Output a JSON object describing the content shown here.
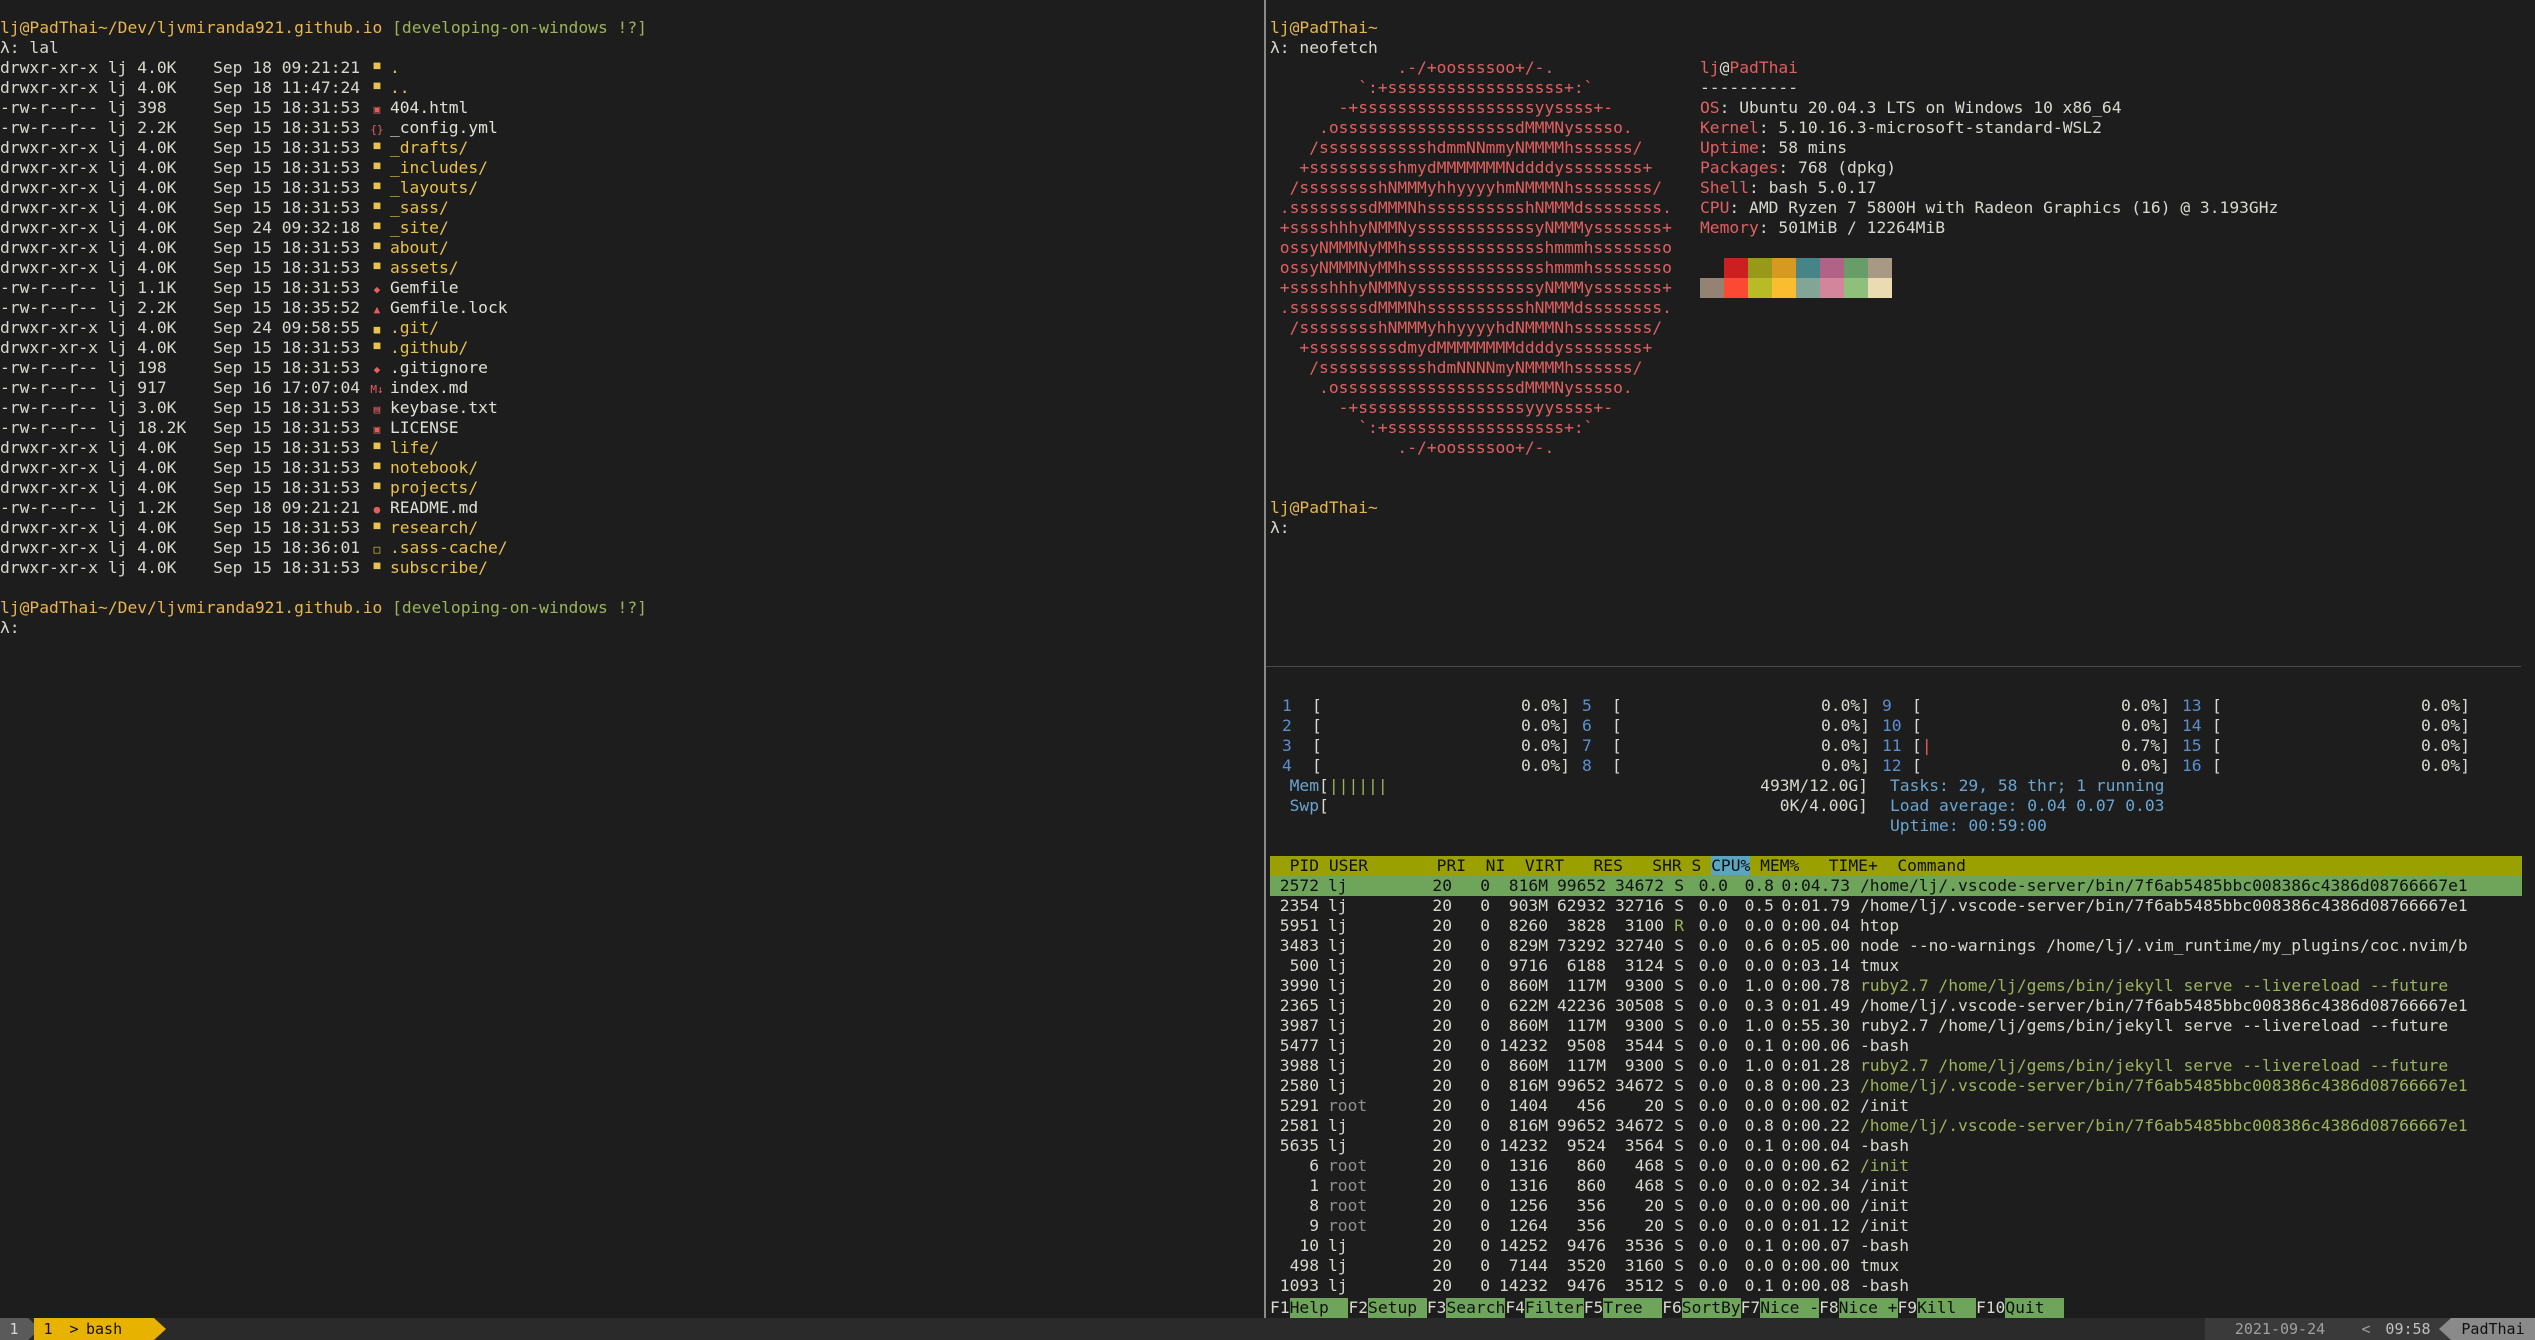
{
  "left": {
    "prompt_user": "lj@PadThai",
    "prompt_path": "~/Dev/ljvmiranda921.github.io",
    "prompt_git": "[developing-on-windows !?]",
    "command": "λ: lal",
    "entries": [
      {
        "perm": "drwxr-xr-x",
        "owner": "lj",
        "size": "4.0K",
        "date": "Sep 18 09:21:21",
        "icon": "folder-icon",
        "glyph": "▀",
        "name": ".",
        "dir": true
      },
      {
        "perm": "drwxr-xr-x",
        "owner": "lj",
        "size": "4.0K",
        "date": "Sep 18 11:47:24",
        "icon": "folder-icon",
        "glyph": "▀",
        "name": "..",
        "dir": true
      },
      {
        "perm": "-rw-r--r--",
        "owner": "lj",
        "size": "398",
        "date": "Sep 15 18:31:53",
        "icon": "html-icon",
        "glyph": "▣",
        "name": "404.html",
        "dir": false
      },
      {
        "perm": "-rw-r--r--",
        "owner": "lj",
        "size": "2.2K",
        "date": "Sep 15 18:31:53",
        "icon": "config-icon",
        "glyph": "{}",
        "name": "_config.yml",
        "dir": false
      },
      {
        "perm": "drwxr-xr-x",
        "owner": "lj",
        "size": "4.0K",
        "date": "Sep 15 18:31:53",
        "icon": "folder-icon",
        "glyph": "▀",
        "name": "_drafts/",
        "dir": true
      },
      {
        "perm": "drwxr-xr-x",
        "owner": "lj",
        "size": "4.0K",
        "date": "Sep 15 18:31:53",
        "icon": "folder-includes-icon",
        "glyph": "▀",
        "name": "_includes/",
        "dir": true
      },
      {
        "perm": "drwxr-xr-x",
        "owner": "lj",
        "size": "4.0K",
        "date": "Sep 15 18:31:53",
        "icon": "folder-icon",
        "glyph": "▀",
        "name": "_layouts/",
        "dir": true
      },
      {
        "perm": "drwxr-xr-x",
        "owner": "lj",
        "size": "4.0K",
        "date": "Sep 15 18:31:53",
        "icon": "folder-icon",
        "glyph": "▀",
        "name": "_sass/",
        "dir": true
      },
      {
        "perm": "drwxr-xr-x",
        "owner": "lj",
        "size": "4.0K",
        "date": "Sep 24 09:32:18",
        "icon": "folder-icon",
        "glyph": "▀",
        "name": "_site/",
        "dir": true
      },
      {
        "perm": "drwxr-xr-x",
        "owner": "lj",
        "size": "4.0K",
        "date": "Sep 15 18:31:53",
        "icon": "folder-icon",
        "glyph": "▀",
        "name": "about/",
        "dir": true
      },
      {
        "perm": "drwxr-xr-x",
        "owner": "lj",
        "size": "4.0K",
        "date": "Sep 15 18:31:53",
        "icon": "folder-icon",
        "glyph": "▀",
        "name": "assets/",
        "dir": true
      },
      {
        "perm": "-rw-r--r--",
        "owner": "lj",
        "size": "1.1K",
        "date": "Sep 15 18:31:53",
        "icon": "ruby-icon",
        "glyph": "◆",
        "name": "Gemfile",
        "dir": false
      },
      {
        "perm": "-rw-r--r--",
        "owner": "lj",
        "size": "2.2K",
        "date": "Sep 15 18:35:52",
        "icon": "lock-icon",
        "glyph": "▲",
        "name": "Gemfile.lock",
        "dir": false
      },
      {
        "perm": "drwxr-xr-x",
        "owner": "lj",
        "size": "4.0K",
        "date": "Sep 24 09:58:55",
        "icon": "git-folder-icon",
        "glyph": "■",
        "name": ".git/",
        "dir": true
      },
      {
        "perm": "drwxr-xr-x",
        "owner": "lj",
        "size": "4.0K",
        "date": "Sep 15 18:31:53",
        "icon": "github-folder-icon",
        "glyph": "▀",
        "name": ".github/",
        "dir": true
      },
      {
        "perm": "-rw-r--r--",
        "owner": "lj",
        "size": "198",
        "date": "Sep 15 18:31:53",
        "icon": "gitignore-icon",
        "glyph": "◆",
        "name": ".gitignore",
        "dir": false
      },
      {
        "perm": "-rw-r--r--",
        "owner": "lj",
        "size": "917",
        "date": "Sep 16 17:07:04",
        "icon": "markdown-icon",
        "glyph": "M↓",
        "name": "index.md",
        "dir": false
      },
      {
        "perm": "-rw-r--r--",
        "owner": "lj",
        "size": "3.0K",
        "date": "Sep 15 18:31:53",
        "icon": "text-file-icon",
        "glyph": "▤",
        "name": "keybase.txt",
        "dir": false
      },
      {
        "perm": "-rw-r--r--",
        "owner": "lj",
        "size": "18.2K",
        "date": "Sep 15 18:31:53",
        "icon": "license-icon",
        "glyph": "▣",
        "name": "LICENSE",
        "dir": false
      },
      {
        "perm": "drwxr-xr-x",
        "owner": "lj",
        "size": "4.0K",
        "date": "Sep 15 18:31:53",
        "icon": "folder-icon",
        "glyph": "▀",
        "name": "life/",
        "dir": true
      },
      {
        "perm": "drwxr-xr-x",
        "owner": "lj",
        "size": "4.0K",
        "date": "Sep 15 18:31:53",
        "icon": "folder-icon",
        "glyph": "▀",
        "name": "notebook/",
        "dir": true
      },
      {
        "perm": "drwxr-xr-x",
        "owner": "lj",
        "size": "4.0K",
        "date": "Sep 15 18:31:53",
        "icon": "folder-icon",
        "glyph": "▀",
        "name": "projects/",
        "dir": true
      },
      {
        "perm": "-rw-r--r--",
        "owner": "lj",
        "size": "1.2K",
        "date": "Sep 18 09:21:21",
        "icon": "info-icon",
        "glyph": "●",
        "name": "README.md",
        "dir": false
      },
      {
        "perm": "drwxr-xr-x",
        "owner": "lj",
        "size": "4.0K",
        "date": "Sep 15 18:31:53",
        "icon": "folder-icon",
        "glyph": "▀",
        "name": "research/",
        "dir": true
      },
      {
        "perm": "drwxr-xr-x",
        "owner": "lj",
        "size": "4.0K",
        "date": "Sep 15 18:36:01",
        "icon": "folder-open-icon",
        "glyph": "□",
        "name": ".sass-cache/",
        "dir": true
      },
      {
        "perm": "drwxr-xr-x",
        "owner": "lj",
        "size": "4.0K",
        "date": "Sep 15 18:31:53",
        "icon": "folder-icon",
        "glyph": "▀",
        "name": "subscribe/",
        "dir": true
      }
    ],
    "prompt2_user": "lj@PadThai",
    "prompt2_path": "~/Dev/ljvmiranda921.github.io",
    "prompt2_git": "[developing-on-windows !?]",
    "prompt2_cmd": "λ:"
  },
  "neofetch": {
    "prompt": "lj@PadThai",
    "prompt_tail": "~",
    "command": "λ: neofetch",
    "logo": [
      "             .-/+oossssoo+/-.",
      "         `:+ssssssssssssssssss+:`",
      "       -+ssssssssssssssssssyyssss+-",
      "     .ossssssssssssssssssdMMMNysssso.",
      "    /ssssssssssshdmmNNmmyNMMMMhssssss/",
      "   +ssssssssshmydMMMMMMMNddddyssssssss+",
      "  /sssssssshNMMMyhhyyyyhmNMMMNhssssssss/",
      " .ssssssssdMMMNhsssssssssshNMMMdssssssss.",
      " +sssshhhyNMMNyssssssssssssyNMMMysssssss+",
      " ossyNMMMNyMMhsssssssssssssshmmmhssssssso",
      " ossyNMMMNyMMhsssssssssssssshmmmhssssssso",
      " +sssshhhyNMMNyssssssssssssyNMMMysssssss+",
      " .ssssssssdMMMNhsssssssssshNMMMdssssssss.",
      "  /sssssssshNMMMyhhyyyyhdNMMMNhssssssss/",
      "   +sssssssssdmydMMMMMMMMddddyssssssss+",
      "    /ssssssssssshdmNNNNmyNMMMMhssssss/",
      "     .ossssssssssssssssssdMMMNysssso.",
      "       -+sssssssssssssssssyyyssss+-",
      "         `:+ssssssssssssssssss+:`",
      "             .-/+oossssoo+/-."
    ],
    "title_user": "lj",
    "title_at": "@",
    "title_host": "PadThai",
    "separator": "----------",
    "info": [
      {
        "key": "OS",
        "value": ": Ubuntu 20.04.3 LTS on Windows 10 x86_64"
      },
      {
        "key": "Kernel",
        "value": ": 5.10.16.3-microsoft-standard-WSL2"
      },
      {
        "key": "Uptime",
        "value": ": 58 mins"
      },
      {
        "key": "Packages",
        "value": ": 768 (dpkg)"
      },
      {
        "key": "Shell",
        "value": ": bash 5.0.17"
      },
      {
        "key": "CPU",
        "value": ": AMD Ryzen 7 5800H with Radeon Graphics (16) @ 3.193GHz"
      },
      {
        "key": "Memory",
        "value": ": 501MiB / 12264MiB"
      }
    ],
    "palette_top": [
      "#1d1d1d",
      "#cc2020",
      "#98981a",
      "#d79921",
      "#458588",
      "#b16286",
      "#689d6a",
      "#a89984"
    ],
    "palette_bottom": [
      "#928374",
      "#fb4934",
      "#b8bb26",
      "#fabd2f",
      "#83a598",
      "#d3869b",
      "#8ec07c",
      "#ebdbb2"
    ],
    "prompt2": "lj@PadThai",
    "prompt2_tail": "~",
    "prompt2_cmd": "λ:"
  },
  "htop": {
    "cpus": [
      {
        "n": "1",
        "v": "0.0%]"
      },
      {
        "n": "2",
        "v": "0.0%]"
      },
      {
        "n": "3",
        "v": "0.0%]"
      },
      {
        "n": "4",
        "v": "0.0%]"
      },
      {
        "n": "5",
        "v": "0.0%]"
      },
      {
        "n": "6",
        "v": "0.0%]"
      },
      {
        "n": "7",
        "v": "0.0%]"
      },
      {
        "n": "8",
        "v": "0.0%]"
      },
      {
        "n": "9",
        "v": "0.0%]"
      },
      {
        "n": "10",
        "v": "0.0%]"
      },
      {
        "n": "11",
        "v": "0.7%]"
      },
      {
        "n": "12",
        "v": "0.0%]"
      },
      {
        "n": "13",
        "v": "0.0%]"
      },
      {
        "n": "14",
        "v": "0.0%]"
      },
      {
        "n": "15",
        "v": "0.0%]"
      },
      {
        "n": "16",
        "v": "0.0%]"
      }
    ],
    "mem_label": "Mem",
    "mem_bar": "||||||",
    "mem_value": "493M/12.0G]",
    "swp_label": "Swp",
    "swp_value": "0K/4.00G]",
    "tasks": "Tasks: 29, 58 thr; 1 running",
    "load": "Load average: 0.04 0.07 0.03",
    "uptime": "Uptime: 00:59:00",
    "header": "  PID USER       PRI  NI  VIRT   RES   SHR S ",
    "header_sort": "CPU%",
    "header_tail": " MEM%   TIME+  Command",
    "processes": [
      {
        "pid": " 2572",
        "user": "lj  ",
        "pri": "20",
        "ni": "0",
        "virt": " 816M",
        "res": "99652",
        "shr": "34672",
        "s": "S",
        "cpu": "0.0",
        "mem": "0.8",
        "time": "0:04.73",
        "cmd": "/home/lj/.vscode-server/bin/7f6ab5485bbc008386c4386d08766667e1",
        "sel": true,
        "kind": ""
      },
      {
        "pid": " 2354",
        "user": "lj  ",
        "pri": "20",
        "ni": "0",
        "virt": " 903M",
        "res": "62932",
        "shr": "32716",
        "s": "S",
        "cpu": "0.0",
        "mem": "0.5",
        "time": "0:01.79",
        "cmd": "/home/lj/.vscode-server/bin/7f6ab5485bbc008386c4386d08766667e1",
        "sel": false,
        "kind": ""
      },
      {
        "pid": " 5951",
        "user": "lj  ",
        "pri": "20",
        "ni": "0",
        "virt": " 8260",
        "res": " 3828",
        "shr": " 3100",
        "s": "R",
        "cpu": "0.0",
        "mem": "0.0",
        "time": "0:00.04",
        "cmd": "htop",
        "sel": false,
        "kind": ""
      },
      {
        "pid": " 3483",
        "user": "lj  ",
        "pri": "20",
        "ni": "0",
        "virt": " 829M",
        "res": "73292",
        "shr": "32740",
        "s": "S",
        "cpu": "0.0",
        "mem": "0.6",
        "time": "0:05.00",
        "cmd": "node --no-warnings /home/lj/.vim_runtime/my_plugins/coc.nvim/b",
        "sel": false,
        "kind": ""
      },
      {
        "pid": "  500",
        "user": "lj  ",
        "pri": "20",
        "ni": "0",
        "virt": " 9716",
        "res": " 6188",
        "shr": " 3124",
        "s": "S",
        "cpu": "0.0",
        "mem": "0.0",
        "time": "0:03.14",
        "cmd": "tmux",
        "sel": false,
        "kind": ""
      },
      {
        "pid": " 3990",
        "user": "lj  ",
        "pri": "20",
        "ni": "0",
        "virt": " 860M",
        "res": " 117M",
        "shr": " 9300",
        "s": "S",
        "cpu": "0.0",
        "mem": "1.0",
        "time": "0:00.78",
        "cmd": "ruby2.7 /home/lj/gems/bin/jekyll serve --livereload --future",
        "sel": false,
        "kind": "thr"
      },
      {
        "pid": " 2365",
        "user": "lj  ",
        "pri": "20",
        "ni": "0",
        "virt": " 622M",
        "res": "42236",
        "shr": "30508",
        "s": "S",
        "cpu": "0.0",
        "mem": "0.3",
        "time": "0:01.49",
        "cmd": "/home/lj/.vscode-server/bin/7f6ab5485bbc008386c4386d08766667e1",
        "sel": false,
        "kind": ""
      },
      {
        "pid": " 3987",
        "user": "lj  ",
        "pri": "20",
        "ni": "0",
        "virt": " 860M",
        "res": " 117M",
        "shr": " 9300",
        "s": "S",
        "cpu": "0.0",
        "mem": "1.0",
        "time": "0:55.30",
        "cmd": "ruby2.7 /home/lj/gems/bin/jekyll serve --livereload --future",
        "sel": false,
        "kind": ""
      },
      {
        "pid": " 5477",
        "user": "lj  ",
        "pri": "20",
        "ni": "0",
        "virt": "14232",
        "res": " 9508",
        "shr": " 3544",
        "s": "S",
        "cpu": "0.0",
        "mem": "0.1",
        "time": "0:00.06",
        "cmd": "-bash",
        "sel": false,
        "kind": ""
      },
      {
        "pid": " 3988",
        "user": "lj  ",
        "pri": "20",
        "ni": "0",
        "virt": " 860M",
        "res": " 117M",
        "shr": " 9300",
        "s": "S",
        "cpu": "0.0",
        "mem": "1.0",
        "time": "0:01.28",
        "cmd": "ruby2.7 /home/lj/gems/bin/jekyll serve --livereload --future",
        "sel": false,
        "kind": "thr"
      },
      {
        "pid": " 2580",
        "user": "lj  ",
        "pri": "20",
        "ni": "0",
        "virt": " 816M",
        "res": "99652",
        "shr": "34672",
        "s": "S",
        "cpu": "0.0",
        "mem": "0.8",
        "time": "0:00.23",
        "cmd": "/home/lj/.vscode-server/bin/7f6ab5485bbc008386c4386d08766667e1",
        "sel": false,
        "kind": "thr"
      },
      {
        "pid": " 5291",
        "user": "root",
        "pri": "20",
        "ni": "0",
        "virt": " 1404",
        "res": "  456",
        "shr": "   20",
        "s": "S",
        "cpu": "0.0",
        "mem": "0.0",
        "time": "0:00.02",
        "cmd": "/init",
        "sel": false,
        "kind": "root"
      },
      {
        "pid": " 2581",
        "user": "lj  ",
        "pri": "20",
        "ni": "0",
        "virt": " 816M",
        "res": "99652",
        "shr": "34672",
        "s": "S",
        "cpu": "0.0",
        "mem": "0.8",
        "time": "0:00.22",
        "cmd": "/home/lj/.vscode-server/bin/7f6ab5485bbc008386c4386d08766667e1",
        "sel": false,
        "kind": "thr"
      },
      {
        "pid": " 5635",
        "user": "lj  ",
        "pri": "20",
        "ni": "0",
        "virt": "14232",
        "res": " 9524",
        "shr": " 3564",
        "s": "S",
        "cpu": "0.0",
        "mem": "0.1",
        "time": "0:00.04",
        "cmd": "-bash",
        "sel": false,
        "kind": ""
      },
      {
        "pid": "    6",
        "user": "root",
        "pri": "20",
        "ni": "0",
        "virt": " 1316",
        "res": "  860",
        "shr": "  468",
        "s": "S",
        "cpu": "0.0",
        "mem": "0.0",
        "time": "0:00.62",
        "cmd": "/init",
        "sel": false,
        "kind": "rootthr"
      },
      {
        "pid": "    1",
        "user": "root",
        "pri": "20",
        "ni": "0",
        "virt": " 1316",
        "res": "  860",
        "shr": "  468",
        "s": "S",
        "cpu": "0.0",
        "mem": "0.0",
        "time": "0:02.34",
        "cmd": "/init",
        "sel": false,
        "kind": "root"
      },
      {
        "pid": "    8",
        "user": "root",
        "pri": "20",
        "ni": "0",
        "virt": " 1256",
        "res": "  356",
        "shr": "   20",
        "s": "S",
        "cpu": "0.0",
        "mem": "0.0",
        "time": "0:00.00",
        "cmd": "/init",
        "sel": false,
        "kind": "root"
      },
      {
        "pid": "    9",
        "user": "root",
        "pri": "20",
        "ni": "0",
        "virt": " 1264",
        "res": "  356",
        "shr": "   20",
        "s": "S",
        "cpu": "0.0",
        "mem": "0.0",
        "time": "0:01.12",
        "cmd": "/init",
        "sel": false,
        "kind": "root"
      },
      {
        "pid": "   10",
        "user": "lj  ",
        "pri": "20",
        "ni": "0",
        "virt": "14252",
        "res": " 9476",
        "shr": " 3536",
        "s": "S",
        "cpu": "0.0",
        "mem": "0.1",
        "time": "0:00.07",
        "cmd": "-bash",
        "sel": false,
        "kind": ""
      },
      {
        "pid": "  498",
        "user": "lj  ",
        "pri": "20",
        "ni": "0",
        "virt": " 7144",
        "res": " 3520",
        "shr": " 3160",
        "s": "S",
        "cpu": "0.0",
        "mem": "0.0",
        "time": "0:00.00",
        "cmd": "tmux",
        "sel": false,
        "kind": ""
      },
      {
        "pid": " 1093",
        "user": "lj  ",
        "pri": "20",
        "ni": "0",
        "virt": "14232",
        "res": " 9476",
        "shr": " 3512",
        "s": "S",
        "cpu": "0.0",
        "mem": "0.1",
        "time": "0:00.08",
        "cmd": "-bash",
        "sel": false,
        "kind": ""
      }
    ],
    "fkeys": [
      {
        "k": "F1",
        "l": "Help  "
      },
      {
        "k": "F2",
        "l": "Setup "
      },
      {
        "k": "F3",
        "l": "Search"
      },
      {
        "k": "F4",
        "l": "Filter"
      },
      {
        "k": "F5",
        "l": "Tree  "
      },
      {
        "k": "F6",
        "l": "SortBy"
      },
      {
        "k": "F7",
        "l": "Nice -"
      },
      {
        "k": "F8",
        "l": "Nice +"
      },
      {
        "k": "F9",
        "l": "Kill  "
      },
      {
        "k": "F10",
        "l": "Quit  "
      }
    ]
  },
  "statusbar": {
    "session": "1",
    "window_index": "1",
    "window_name": "bash",
    "date": "2021-09-24",
    "time": "09:58",
    "host": "PadThai"
  }
}
